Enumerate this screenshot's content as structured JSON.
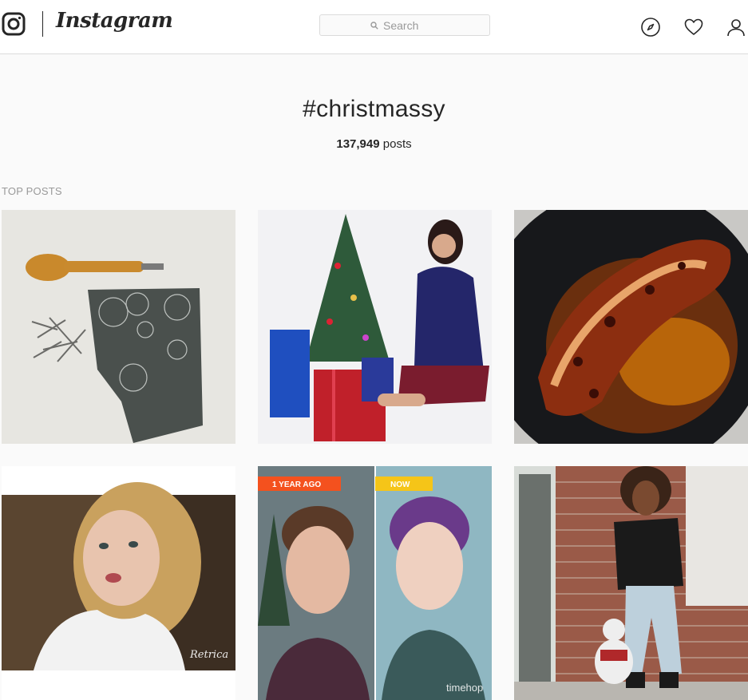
{
  "header": {
    "brand": "Instagram",
    "search_placeholder": "Search",
    "icons": [
      "instagram-logo-icon",
      "search-icon",
      "compass-icon",
      "heart-icon",
      "profile-icon"
    ]
  },
  "hashtag": {
    "title": "#christmassy",
    "post_count": "137,949",
    "post_count_suffix": "posts"
  },
  "top_posts": {
    "label": "TOP POSTS",
    "posts": [
      {
        "subject": "linocut carving",
        "overlay_text": ""
      },
      {
        "subject": "christmas tree",
        "overlay_text": ""
      },
      {
        "subject": "roast dish",
        "overlay_text": ""
      },
      {
        "subject": "selfie",
        "overlay_text": "Retrica"
      },
      {
        "subject": "timehop",
        "overlay_left": "1 YEAR AGO",
        "overlay_right": "NOW",
        "overlay_text": "timehop"
      },
      {
        "subject": "outfit",
        "overlay_text": ""
      }
    ]
  },
  "colors": {
    "background": "#fafafa",
    "border": "#dbdbdb",
    "text": "#262626",
    "muted": "#999999",
    "timehop_left": "#f4511e",
    "timehop_right": "#f5c518"
  }
}
